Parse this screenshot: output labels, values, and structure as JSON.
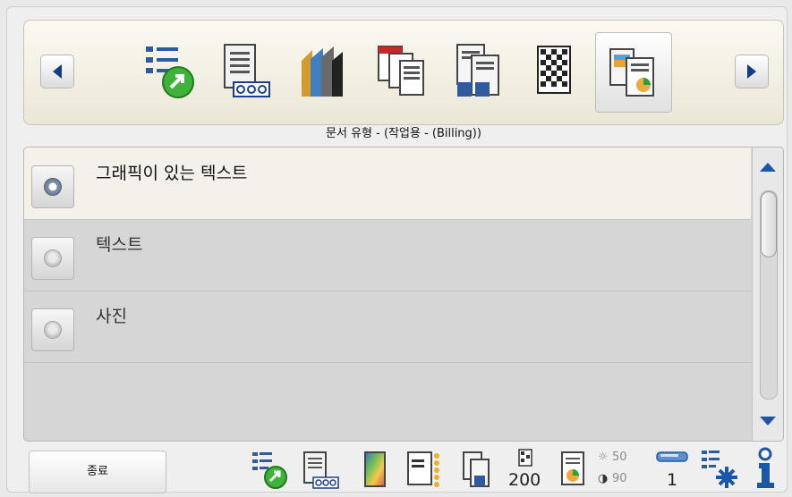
{
  "toolbar": {
    "nav_left_icon": "chevron-left-icon",
    "nav_right_icon": "chevron-right-icon",
    "tools": [
      {
        "name": "settings-shortcut-icon"
      },
      {
        "name": "document-numbering-icon"
      },
      {
        "name": "color-stack-icon"
      },
      {
        "name": "file-type-icon"
      },
      {
        "name": "multipage-document-icon"
      },
      {
        "name": "barcode-icon"
      },
      {
        "name": "document-type-icon",
        "selected": true
      }
    ]
  },
  "doctype_label": "문서 유형 - (작업용 - (Billing))",
  "options": [
    {
      "label": "그래픽이 있는 텍스트",
      "selected": true
    },
    {
      "label": "텍스트",
      "selected": false
    },
    {
      "label": "사진",
      "selected": false
    }
  ],
  "bottom": {
    "finish_label": "종료",
    "resolution": "200",
    "brightness": "50",
    "contrast": "90",
    "count": "1"
  },
  "colors": {
    "accent": "#1b57a7",
    "nav_arrow": "#123e87",
    "selected_row": "#f4f1ea",
    "list_bg": "#d6d6d6"
  }
}
